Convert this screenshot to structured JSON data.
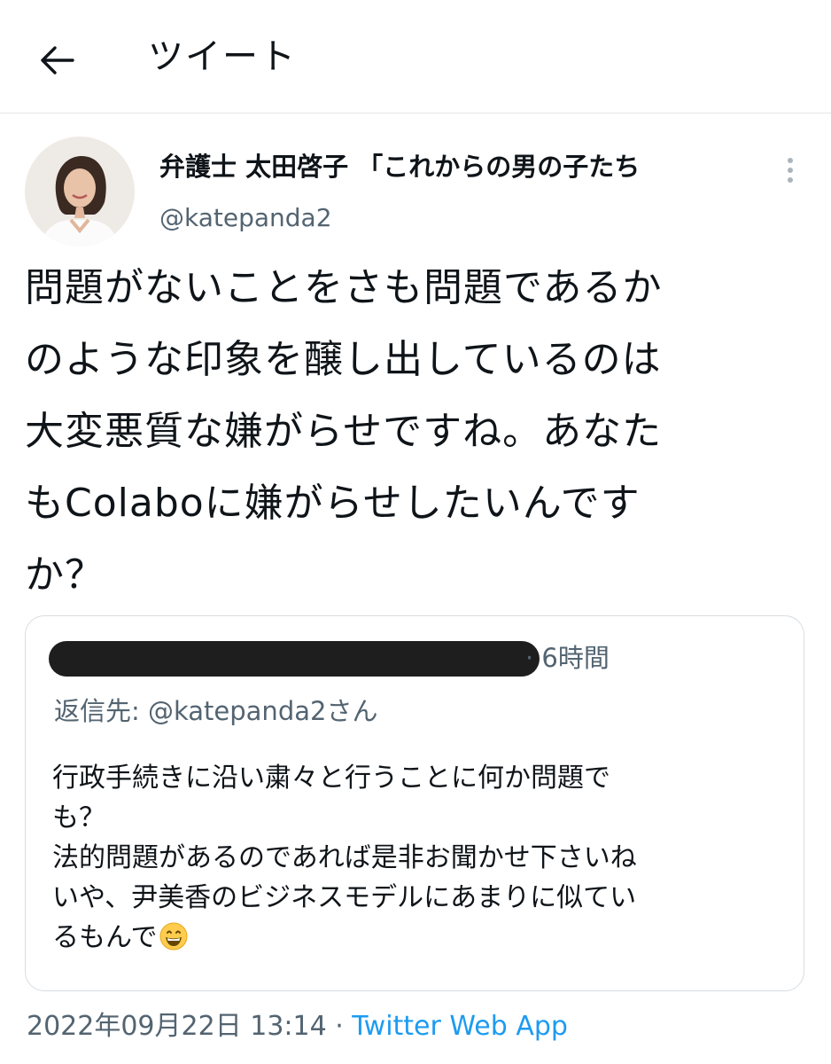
{
  "header": {
    "back_icon": "arrow-left-icon",
    "title": "ツイート"
  },
  "author": {
    "display_name": "弁護士 太田啓子 「これからの男の子たち",
    "handle": "@katepanda2",
    "more_icon": "vertical-ellipsis-icon"
  },
  "tweet": {
    "text": "問題がないことをさも問題であるか\nのような印象を醸し出しているのは\n大変悪質な嫌がらせですね。あなた\nもColaboに嫌がらせしたいんです\nか？"
  },
  "quoted_tweet": {
    "time": "· 6時間",
    "reply_to": "返信先: @katepanda2さん",
    "text": "行政手続きに沿い粛々と行うことに何か問題で\nも？\n法的問題があるのであれば是非お聞かせ下さいね\nいや、尹美香のビジネスモデルにあまりに似てい\nるもんで",
    "emoji": "grinning-face-emoji"
  },
  "meta": {
    "timestamp": "2022年09月22日 13:14",
    "separator": " · ",
    "app": "Twitter Web App"
  },
  "colors": {
    "text": "#0f1419",
    "secondary": "#536471",
    "link": "#1d9bf0",
    "border": "#d8dde1"
  }
}
